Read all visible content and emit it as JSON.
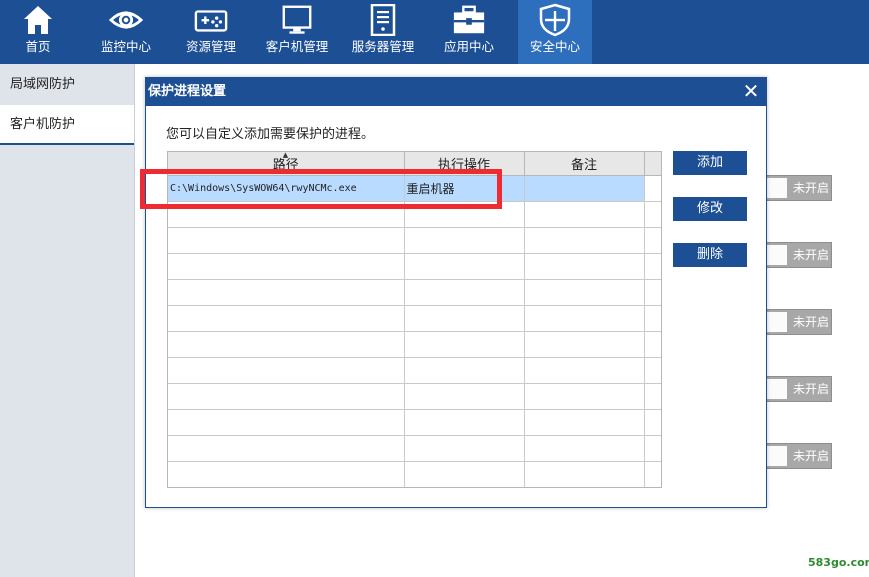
{
  "nav": {
    "items": [
      {
        "label": "首页",
        "icon": "home-icon"
      },
      {
        "label": "监控中心",
        "icon": "eye-icon"
      },
      {
        "label": "资源管理",
        "icon": "gamepad-icon"
      },
      {
        "label": "客户机管理",
        "icon": "monitor-icon"
      },
      {
        "label": "服务器管理",
        "icon": "server-icon"
      },
      {
        "label": "应用中心",
        "icon": "toolbox-icon"
      },
      {
        "label": "安全中心",
        "icon": "shield-icon"
      }
    ],
    "active_index": 6,
    "bg_color": "#1c4f94",
    "active_color": "#2e6fbd"
  },
  "sidebar": {
    "items": [
      {
        "label": "局域网防护"
      },
      {
        "label": "客户机防护"
      }
    ],
    "active_index": 1
  },
  "toggles": [
    {
      "label": "未开启"
    },
    {
      "label": "未开启"
    },
    {
      "label": "未开启"
    },
    {
      "label": "未开启"
    },
    {
      "label": "未开启"
    }
  ],
  "dialog": {
    "title": "保护进程设置",
    "close_icon": "close-icon",
    "description": "您可以自定义添加需要保护的进程。",
    "table": {
      "columns": [
        "路径",
        "执行操作",
        "备注"
      ],
      "rows": [
        {
          "path": "C:\\Windows\\SysWOW64\\rwyNCMc.exe",
          "action": "重启机器",
          "note": ""
        }
      ],
      "selected_row": 0
    },
    "buttons": {
      "add": "添加",
      "edit": "修改",
      "delete": "删除"
    }
  },
  "watermark": "583go.com",
  "highlight_color": "#ee2b33"
}
